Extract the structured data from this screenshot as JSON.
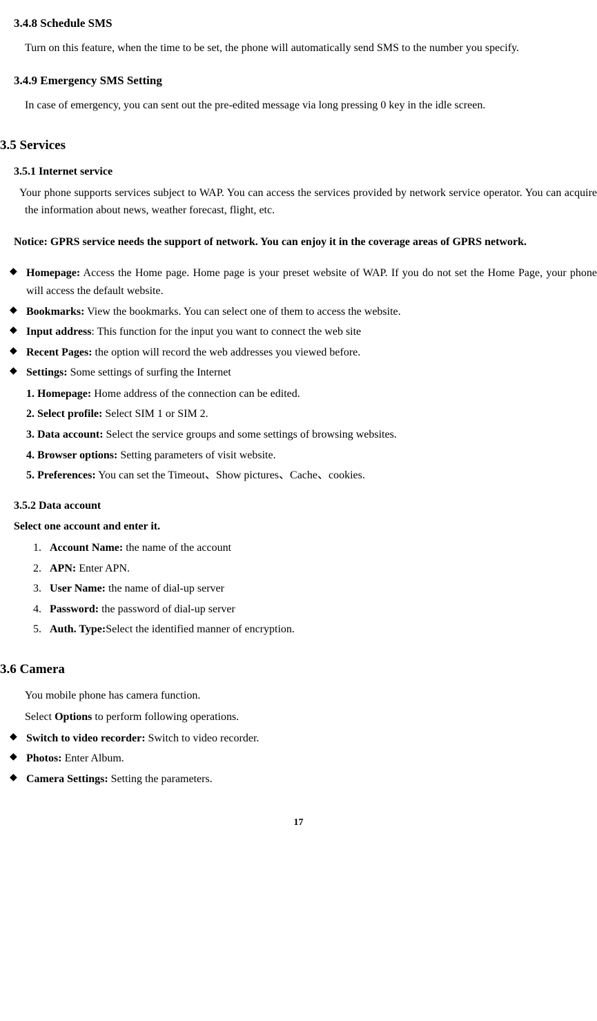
{
  "s348": {
    "heading": "3.4.8 Schedule SMS",
    "para": "Turn on this feature, when the time to be set, the phone will automatically send SMS to the number you specify."
  },
  "s349": {
    "heading": "3.4.9 Emergency SMS Setting",
    "para": "In case of emergency, you can sent out the pre-edited message via long pressing 0 key in the idle screen."
  },
  "s35": {
    "heading": "3.5 Services"
  },
  "s351": {
    "heading": "3.5.1 Internet service",
    "para": "Your phone supports services subject to WAP. You can access the services provided by network service operator. You can acquire the information about news, weather forecast, flight, etc.",
    "notice": "Notice: GPRS service needs the support of network. You can enjoy it in the coverage areas of GPRS network.",
    "bullets": {
      "homepage_label": "Homepage:",
      "homepage_text": " Access the Home page. Home page is your preset website of WAP. If you do not set the Home Page, your phone will access the default website.",
      "bookmarks_label": "Bookmarks:",
      "bookmarks_text": " View the bookmarks. You can select one of them to access the website.",
      "input_label": "Input address",
      "input_text": ": This function for the input you want to connect the web site",
      "recent_label": "Recent Pages:",
      "recent_text": " the option will record the web addresses you viewed before.",
      "settings_label": "Settings:",
      "settings_text": " Some settings of surfing the Internet"
    },
    "settings_sub": {
      "r1_label": "1. Homepage:",
      "r1_text": " Home address of the connection can be edited.",
      "r2_label": "2. Select profile:",
      "r2_text": " Select SIM 1 or SIM 2.",
      "r3_label": "3. Data account:",
      "r3_text": " Select the service groups and some settings of browsing websites.",
      "r4_label": "4. Browser options:",
      "r4_text": " Setting parameters of visit website.",
      "r5_label": "5. Preferences:",
      "r5_text": " You can set the Timeout、Show pictures、Cache、cookies."
    }
  },
  "s352": {
    "heading": "3.5.2 Data account",
    "select": "Select one account and enter it.",
    "ol": {
      "r1_label": "Account Name:",
      "r1_text": " the name of the account",
      "r2_label": "APN:",
      "r2_text": " Enter APN.",
      "r3_label": "User Name:",
      "r3_text": " the name of dial-up server",
      "r4_label": "Password:",
      "r4_text": " the password of dial-up server",
      "r5_label": "Auth. Type:",
      "r5_text": "Select the identified manner of encryption."
    }
  },
  "s36": {
    "heading": "3.6 Camera",
    "intro1": "You mobile phone has camera function.",
    "intro2_a": "Select ",
    "intro2_b": "Options",
    "intro2_c": " to perform following operations.",
    "bullets": {
      "switch_label": "Switch to video recorder:",
      "switch_text": " Switch to video recorder.",
      "photos_label": "Photos:",
      "photos_text": " Enter Album.",
      "camset_label": "Camera Settings:",
      "camset_text": " Setting the parameters."
    }
  },
  "page_number": "17"
}
